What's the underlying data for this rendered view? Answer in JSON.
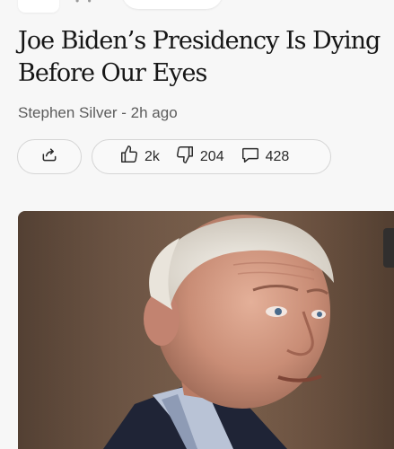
{
  "article": {
    "headline": "Joe Biden’s Presidency Is Dying Before Our Eyes",
    "author": "Stephen Silver",
    "separator": "-",
    "time_ago": "2h ago",
    "byline": "Stephen Silver - 2h ago"
  },
  "actions": {
    "share_icon": "share-icon",
    "likes": "2k",
    "like_icon": "thumbs-up-icon",
    "dislikes": "204",
    "dislike_icon": "thumbs-down-icon",
    "comments": "428",
    "comment_icon": "comment-icon"
  },
  "colors": {
    "background": "#f7f7f7",
    "pill_border": "#d5d5d5",
    "text": "#1b1b1b",
    "byline": "#5c5c5c"
  }
}
